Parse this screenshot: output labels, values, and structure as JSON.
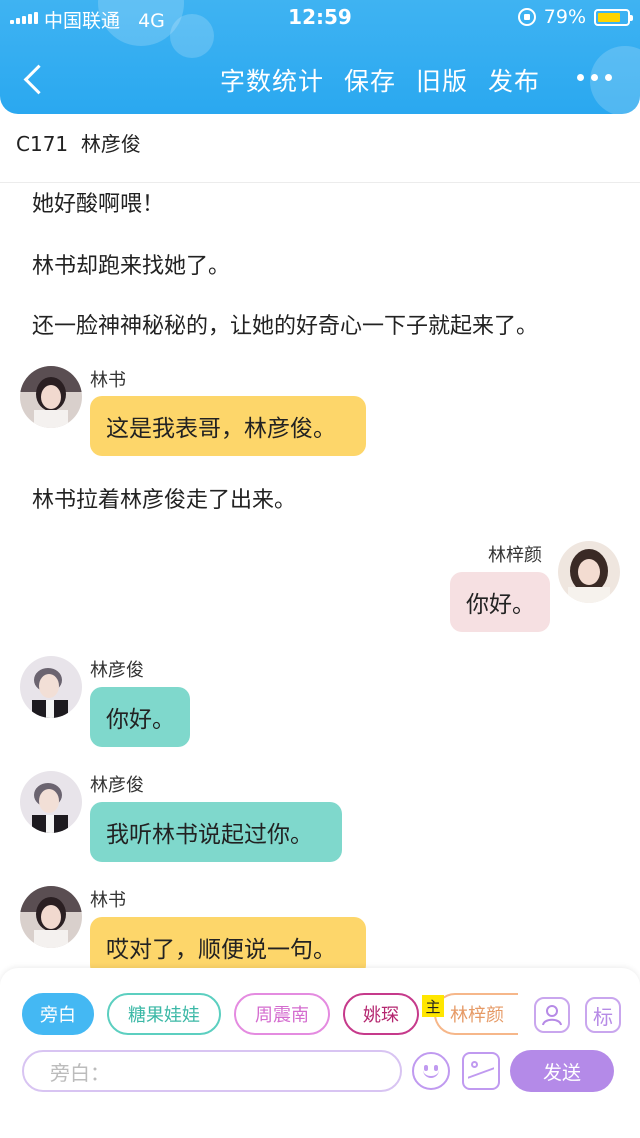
{
  "status_bar": {
    "carrier": "中国联通",
    "network": "4G",
    "time": "12:59",
    "battery": "79%",
    "battery_level": 0.79
  },
  "nav": {
    "actions": [
      "字数统计",
      "保存",
      "旧版",
      "发布"
    ]
  },
  "chapter": {
    "title": "C171  林彦俊"
  },
  "content": {
    "paragraphs": [
      "她好酸啊喂！",
      "林书却跑来找她了。",
      "还一脸神神秘秘的，让她的好奇心一下子就起来了。",
      "林书拉着林彦俊走了出来。"
    ],
    "messages": [
      {
        "speaker": "林书",
        "text": "这是我表哥，林彦俊。"
      },
      {
        "speaker": "林梓颜",
        "text": "你好。"
      },
      {
        "speaker": "林彦俊",
        "text": "你好。"
      },
      {
        "speaker": "林彦俊",
        "text": "我听林书说起过你。"
      },
      {
        "speaker": "林书",
        "text": "哎对了，顺便说一句。"
      }
    ]
  },
  "composer": {
    "roles": [
      "旁白",
      "糖果娃娃",
      "周震南",
      "姚琛",
      "林梓颜"
    ],
    "main_badge": "主",
    "mark_button": "标",
    "input_placeholder": "旁白：",
    "send_label": "发送"
  },
  "colors": {
    "header": "#2aa8f0",
    "bubble_yellow": "#fdd66a",
    "bubble_teal": "#7fd8cc",
    "bubble_pink": "#f6e0e2",
    "accent_purple": "#b48ae8"
  }
}
